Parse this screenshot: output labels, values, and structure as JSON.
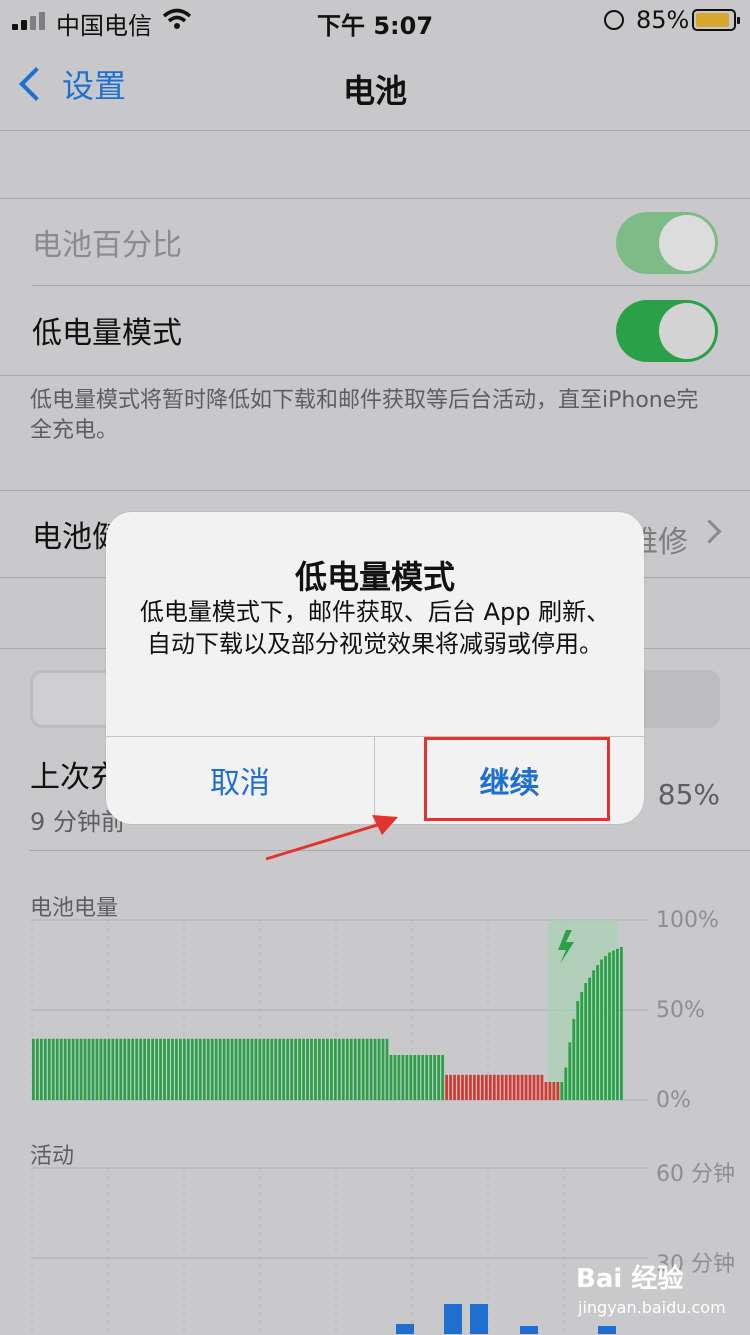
{
  "status_bar": {
    "carrier": "中国电信",
    "time": "下午 5:07",
    "battery_pct": "85%"
  },
  "nav": {
    "back_label": "设置",
    "title": "电池"
  },
  "settings": {
    "battery_percentage_label": "电池百分比",
    "battery_percentage_on": true,
    "low_power_label": "低电量模式",
    "low_power_on": true,
    "low_power_footnote": "低电量模式将暂时降低如下载和邮件获取等后台活动，直至iPhone完全充电。",
    "battery_health_label": "电池健康",
    "battery_health_value": "维修"
  },
  "last_charge": {
    "title": "上次充电",
    "subtitle": "9 分钟前",
    "level": "85%"
  },
  "battery_chart": {
    "label": "电池电量",
    "axis": [
      "100%",
      "50%",
      "0%"
    ]
  },
  "activity_chart": {
    "label": "活动",
    "axis": [
      "60 分钟",
      "30 分钟"
    ]
  },
  "dialog": {
    "title": "低电量模式",
    "message": "低电量模式下，邮件获取、后台 App 刷新、自动下载以及部分视觉效果将减弱或停用。",
    "cancel": "取消",
    "continue": "继续"
  },
  "watermark": {
    "main": "Bai 经验",
    "sub": "jingyan.baidu.com"
  },
  "colors": {
    "accent": "#1f6fd0",
    "toggle_on": "#2aa148",
    "bar_green": "#2aa148",
    "bar_red": "#d43a35",
    "annotation": "#e2332e"
  },
  "chart_data": {
    "type": "bar",
    "title": "电池电量",
    "ylim": [
      0,
      100
    ],
    "y_ticks": [
      "100%",
      "50%",
      "0%"
    ],
    "series": [
      {
        "values": [
          34,
          34,
          34,
          34,
          34,
          34,
          34,
          34,
          34,
          34,
          34,
          34,
          34,
          34,
          34,
          34,
          34,
          34,
          34,
          34,
          34,
          34,
          34,
          34,
          34,
          34,
          34,
          34,
          34,
          34,
          34,
          34,
          34,
          34,
          34,
          34,
          34,
          34,
          34,
          34,
          34,
          34,
          34,
          34,
          34,
          34,
          34,
          34,
          34,
          34,
          34,
          34,
          34,
          34,
          34,
          34,
          34,
          34,
          34,
          34,
          34,
          34,
          34,
          34,
          34,
          34,
          34,
          34,
          34,
          34,
          34,
          34,
          34,
          34,
          34,
          34,
          34,
          34,
          34,
          34,
          34,
          34,
          34,
          34,
          34,
          34,
          34,
          34,
          34,
          34,
          25,
          25,
          25,
          25,
          25,
          25,
          25,
          25,
          25,
          25,
          25,
          25,
          25,
          25,
          14,
          14,
          14,
          14,
          14,
          14,
          14,
          14,
          14,
          14,
          14,
          14,
          14,
          14,
          14,
          14,
          14,
          14,
          14,
          14,
          14,
          14,
          14,
          14,
          14,
          10,
          10,
          10,
          10,
          10,
          18,
          32,
          45,
          55,
          60,
          65,
          68,
          72,
          75,
          78,
          80,
          82,
          83,
          84,
          85
        ]
      }
    ]
  }
}
